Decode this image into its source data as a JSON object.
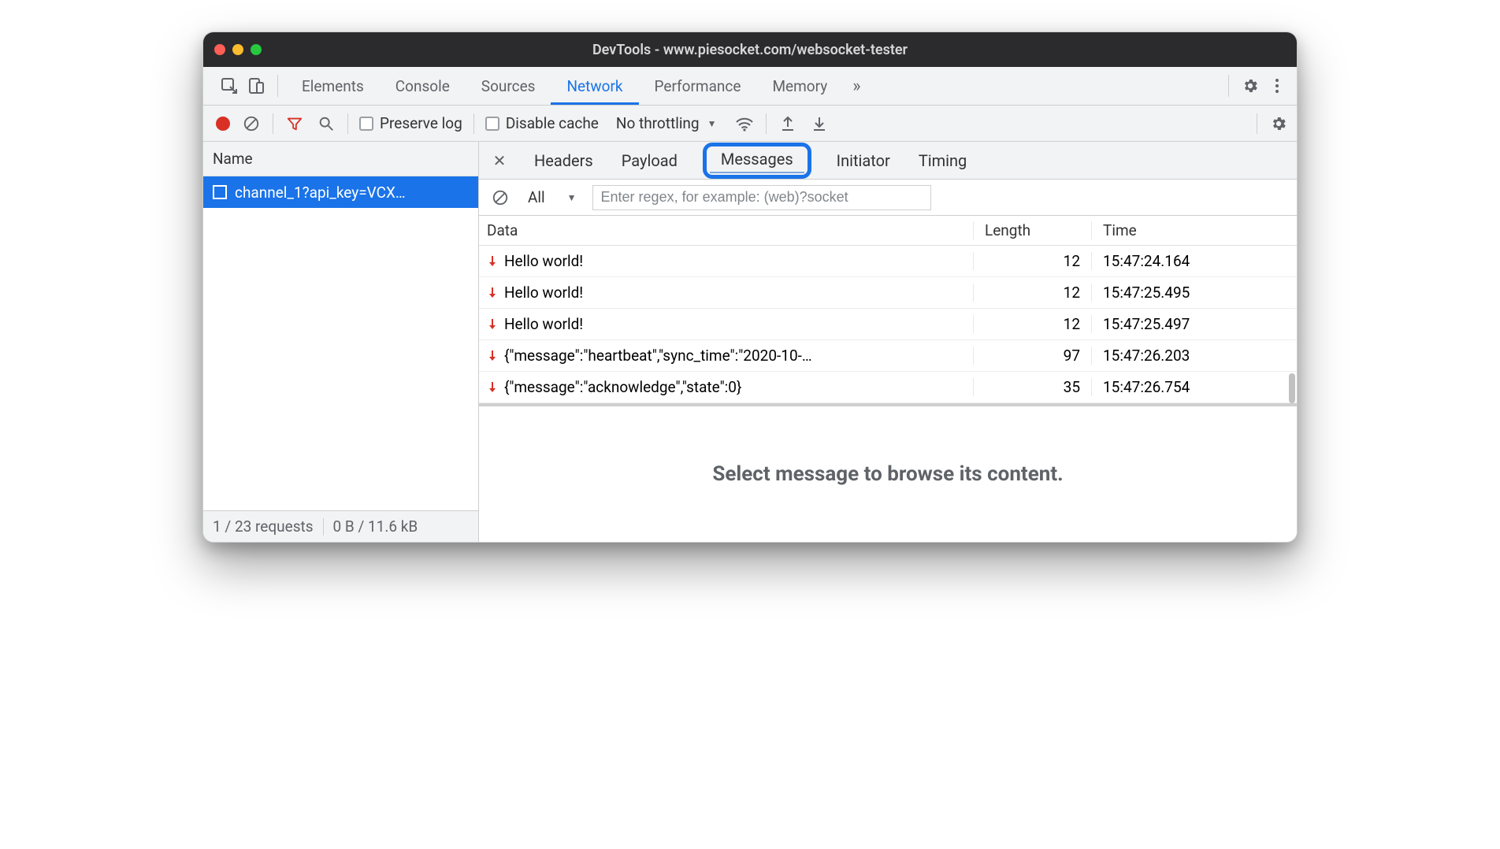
{
  "window": {
    "title": "DevTools - www.piesocket.com/websocket-tester"
  },
  "main_tabs": {
    "items": [
      "Elements",
      "Console",
      "Sources",
      "Network",
      "Performance",
      "Memory"
    ],
    "active_index": 3,
    "more_glyph": "»"
  },
  "net_toolbar": {
    "preserve_log": "Preserve log",
    "disable_cache": "Disable cache",
    "throttling": "No throttling"
  },
  "left": {
    "header": "Name",
    "request": "channel_1?api_key=VCX…",
    "status_requests": "1 / 23 requests",
    "status_transfer": "0 B / 11.6 kB"
  },
  "right_tabs": {
    "items": [
      "Headers",
      "Payload",
      "Messages",
      "Initiator",
      "Timing"
    ],
    "active_index": 2
  },
  "msg_filter": {
    "all": "All",
    "placeholder": "Enter regex, for example: (web)?socket"
  },
  "msg_table": {
    "headers": {
      "data": "Data",
      "length": "Length",
      "time": "Time"
    },
    "rows": [
      {
        "data": "Hello world!",
        "length": "12",
        "time": "15:47:24.164"
      },
      {
        "data": "Hello world!",
        "length": "12",
        "time": "15:47:25.495"
      },
      {
        "data": "Hello world!",
        "length": "12",
        "time": "15:47:25.497"
      },
      {
        "data": "{\"message\":\"heartbeat\",\"sync_time\":\"2020-10-…",
        "length": "97",
        "time": "15:47:26.203"
      },
      {
        "data": "{\"message\":\"acknowledge\",\"state\":0}",
        "length": "35",
        "time": "15:47:26.754"
      }
    ]
  },
  "placeholder": "Select message to browse its content."
}
